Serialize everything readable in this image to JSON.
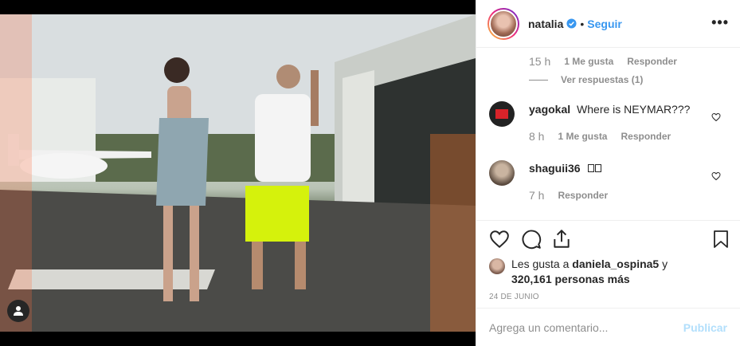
{
  "post": {
    "author": "natalia",
    "separator": "•",
    "follow_label": "Seguir",
    "more_label": "•••"
  },
  "comments": {
    "first_meta": {
      "time": "15 h",
      "likes": "1 Me gusta",
      "reply": "Responder"
    },
    "view_replies": "Ver respuestas (1)",
    "items": [
      {
        "user": "yagokal",
        "text": "Where is NEYMAR???",
        "time": "8 h",
        "likes": "1 Me gusta",
        "reply": "Responder"
      },
      {
        "user": "shaguii36",
        "text": "",
        "time": "7 h",
        "reply": "Responder"
      }
    ]
  },
  "likes": {
    "prefix": "Les gusta a",
    "user": "daniela_ospina5",
    "joiner": "y",
    "count_text": "320,161 personas más"
  },
  "date": "24 DE JUNIO",
  "composer": {
    "placeholder": "Agrega un comentario...",
    "publish_label": "Publicar"
  },
  "colors": {
    "accent": "#3897f0",
    "publish_disabled": "#b2dffc",
    "muted": "#8e8e8e"
  },
  "icons": [
    "user-tag-icon",
    "verified-badge-icon",
    "heart-icon",
    "comment-icon",
    "share-icon",
    "bookmark-icon"
  ]
}
